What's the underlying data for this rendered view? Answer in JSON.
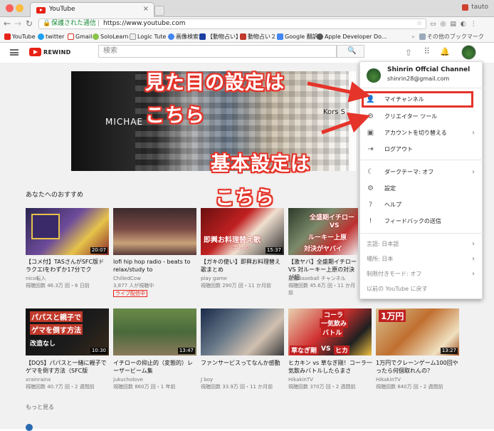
{
  "browser": {
    "tab_title": "YouTube",
    "user": "tauto",
    "secure_label": "保護された通信",
    "url": "https://www.youtube.com",
    "bookmarks": [
      {
        "label": "YouTube",
        "color": "#e62117"
      },
      {
        "label": "twitter",
        "color": "#1da1f2"
      },
      {
        "label": "Gmail",
        "color": "#d93025"
      },
      {
        "label": "SoloLearn",
        "color": "#8bc34a"
      },
      {
        "label": "Logic Tute",
        "color": "#777777"
      },
      {
        "label": "画像検索",
        "color": "#4285f4"
      },
      {
        "label": "【動物占い】",
        "color": "#1a3fa0"
      },
      {
        "label": "動物占い２",
        "color": "#c0392b"
      },
      {
        "label": "Google 翻訳",
        "color": "#4285f4"
      },
      {
        "label": "Apple Developer Do...",
        "color": "#555555"
      }
    ],
    "other_bookmarks": "その他のブックマーク"
  },
  "youtube": {
    "logo_text": "REWIND",
    "search_placeholder": "検索",
    "banner_name": "MICHAE",
    "banner_side_text": "Kors S",
    "section_title": "あなたへのおすすめ",
    "more_label": "もっと見る",
    "videos": [
      {
        "title": "【コメ付】TASさんがSFC版ドラクエIをわずか17分でク",
        "channel": "nico転入",
        "meta": "視聴回数 46.3万 回・6 日前",
        "duration": "20:07",
        "bg": "linear-gradient(135deg,#2a2550 0%,#6d4b9a 45%,#e6c34a 70%,#8a2a2a 100%)"
      },
      {
        "title": "lofi hip hop radio - beats to relax/study to",
        "channel": "ChilledCow",
        "meta": "3,877 人が視聴中",
        "badge": "ライブ配信中",
        "duration": "",
        "bg": "linear-gradient(180deg,#3b2a2c 0%,#7a4a45 45%,#c9a27a 75%,#5a3a3a 100%)"
      },
      {
        "title": "【ガキの使い】即興お料理替え歌まとめ",
        "channel": "play game",
        "meta": "視聴回数 290万 回・11 か月前",
        "duration": "15:37",
        "bg": "linear-gradient(135deg,#6a1010 0%,#c02020 40%,#f0e0d0 60%,#2a2a2a 100%)"
      },
      {
        "title": "【激ヤバ】全盛期イチロー VS 対ルーキー上原の対決が超",
        "channel": "週間Baseball チャンネル",
        "meta": "視聴回数 45.6万 回・11 か月前",
        "duration": "",
        "bg": "linear-gradient(135deg,#2d3a2a 0%,#7a8a6a 40%,#c03030 70%,#f0f0f0 100%)"
      },
      {
        "title": "【DQ5】パパスと一緒に親子でゲマを倒す方法（SFC版",
        "channel": "xrainrainx",
        "meta": "視聴回数 40.7万 回・2 週間前",
        "duration": "10:30",
        "bg": "linear-gradient(135deg,#111 0%,#1c1c1c 60%,#3a2a1a 100%)"
      },
      {
        "title": "イチローの抑止的（変態的）レーザービーム集",
        "channel": "jukucholove",
        "meta": "視聴回数 860万 回・1 年前",
        "duration": "13:47",
        "bg": "linear-gradient(180deg,#6a8a4a 0%,#4a6a3a 50%,#8a7a5a 100%)"
      },
      {
        "title": "ファンサービスってなんか感動",
        "channel": "J boy",
        "meta": "視聴回数 33.9万 回・11 か月前",
        "duration": "",
        "bg": "linear-gradient(135deg,#1a2a4a 0%,#6a7a8a 40%,#d0c0b0 70%,#3a3a3a 100%)"
      },
      {
        "title": "ヒカキン vs 草なぎ剛！コーラ一気飲みバトルしたらまさ",
        "channel": "HikakinTV",
        "meta": "視聴回数 370万 回・2 週間前",
        "duration": "13:50",
        "bg": "linear-gradient(135deg,#e8d0b0 0%,#d03030 45%,#202020 75%,#f0c040 100%)"
      },
      {
        "title": "1万円でクレーンゲーム100回やったら何個取れんの？",
        "channel": "HikakinTV",
        "meta": "視聴回数 840万 回・2 週間前",
        "duration": "13:27",
        "bg": "linear-gradient(135deg,#d8c090 0%,#c07030 45%,#f0e0c0 80%,#a05020 100%)"
      }
    ],
    "thumb_texts": {
      "dq": "パパスと親子で",
      "dq2": "ゲマを倒す方法",
      "dq3": "改造なし",
      "t3": "即興お料理替え歌",
      "t3b": "まとめ",
      "t4": "全盛期イチロー",
      "t4b": "VS",
      "t4c": "ルーキー上原",
      "t4d": "対決がヤバイ",
      "t8": "コーラ",
      "t8b": "一気飲み",
      "t8c": "バトル",
      "t8d": "草なぎ剛",
      "t8e": "VS",
      "t8f": "ヒカ",
      "t9": "1万円"
    }
  },
  "account_menu": {
    "channel_name": "Shinrin Offcial Channel",
    "email": "shinrin28@gmail.com",
    "items": [
      {
        "label": "マイチャンネル",
        "icon": "person-icon"
      },
      {
        "label": "クリエイター ツール",
        "icon": "gear-icon"
      },
      {
        "label": "アカウントを切り替える",
        "icon": "switch-account-icon",
        "chevron": true
      },
      {
        "label": "ログアウト",
        "icon": "logout-icon"
      },
      {
        "label": "ダークテーマ: オフ",
        "icon": "moon-icon",
        "chevron": true
      },
      {
        "label": "設定",
        "icon": "gear-icon"
      },
      {
        "label": "ヘルプ",
        "icon": "help-icon"
      },
      {
        "label": "フィードバックの送信",
        "icon": "feedback-icon"
      },
      {
        "label": "言語: 日本語",
        "chevron": true
      },
      {
        "label": "場所: 日本",
        "chevron": true
      },
      {
        "label": "制限付きモード: オフ",
        "chevron": true
      },
      {
        "label": "以前の YouTube に戻す"
      }
    ]
  },
  "annotations": {
    "line1": "見た目の設定は",
    "line2": "こちら",
    "line3": "基本設定は",
    "line4": "こちら",
    "accent": "#e5342a"
  }
}
